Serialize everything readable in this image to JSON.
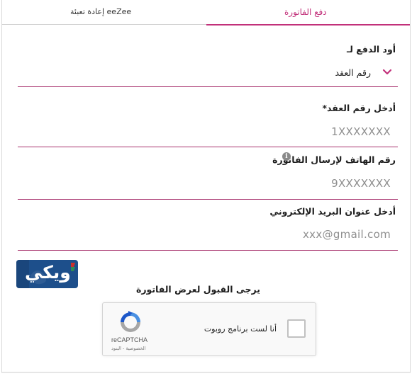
{
  "tabs": {
    "refill_label": "إعادة تعبئة eeZee",
    "pay_label": "دفع الفاتورة"
  },
  "form": {
    "pay_for_label": "أود الدفع لـ",
    "pay_for_value": "رقم العقد",
    "contract_label": "أدخل رقم العقد*",
    "contract_placeholder": "1XXXXXXX",
    "phone_label": "رقم الهاتف لإرسال الفاتورة",
    "phone_placeholder": "9XXXXXXX",
    "email_label": "أدخل عنوان البريد الإلكتروني",
    "email_placeholder": "xxx@gmail.com"
  },
  "logo": {
    "text": "ويكي"
  },
  "captcha": {
    "instruction": "يرجى القبول لعرض الفاتورة",
    "checkbox_label": "أنا لست برنامج روبوت",
    "brand": "reCAPTCHA",
    "links": "الخصوصية - البنود"
  },
  "colors": {
    "accent": "#c2307a",
    "field_line": "#a8336e",
    "logo_bg": "#1d4f8b"
  }
}
